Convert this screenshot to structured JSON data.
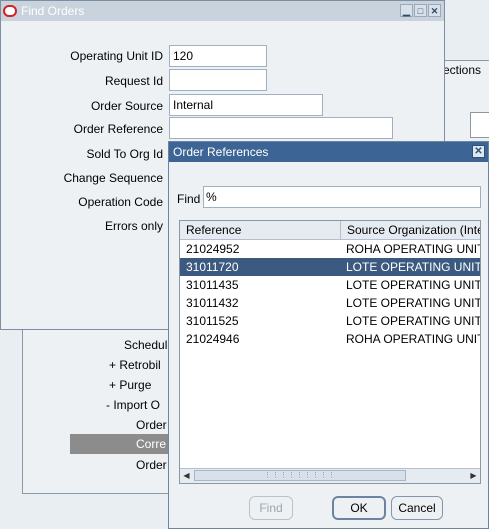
{
  "background": {
    "right_text": "ections",
    "items": [
      {
        "label": "Schedul"
      },
      {
        "label": "+  Retrobil"
      },
      {
        "label": "+  Purge"
      },
      {
        "label": "-  Import O"
      },
      {
        "label": "Order"
      },
      {
        "label": "Corre"
      },
      {
        "label": "Order"
      }
    ]
  },
  "find_orders": {
    "title": "Find Orders",
    "fields": [
      {
        "label": "Operating Unit ID",
        "value": "120"
      },
      {
        "label": "Request Id",
        "value": ""
      },
      {
        "label": "Order Source",
        "value": "Internal"
      },
      {
        "label": "Order Reference",
        "value": ""
      },
      {
        "label": "Sold To Org Id",
        "value": ""
      },
      {
        "label": "Change Sequence",
        "value": ""
      },
      {
        "label": "Operation Code",
        "value": ""
      },
      {
        "label": "Errors only",
        "value": ""
      }
    ]
  },
  "dialog": {
    "title": "Order References",
    "find_label": "Find",
    "find_value": "%",
    "columns": [
      "Reference",
      "Source Organization (Inte"
    ],
    "rows": [
      {
        "reference": "21024952",
        "source": "ROHA OPERATING UNIT"
      },
      {
        "reference": "31011720",
        "source": "LOTE OPERATING UNIT"
      },
      {
        "reference": "31011435",
        "source": "LOTE OPERATING UNIT"
      },
      {
        "reference": "31011432",
        "source": "LOTE OPERATING UNIT"
      },
      {
        "reference": "31011525",
        "source": "LOTE OPERATING UNIT"
      },
      {
        "reference": "21024946",
        "source": "ROHA OPERATING UNIT"
      }
    ],
    "selected_row": 1,
    "buttons": {
      "find": "Find",
      "ok": "OK",
      "cancel": "Cancel"
    }
  }
}
